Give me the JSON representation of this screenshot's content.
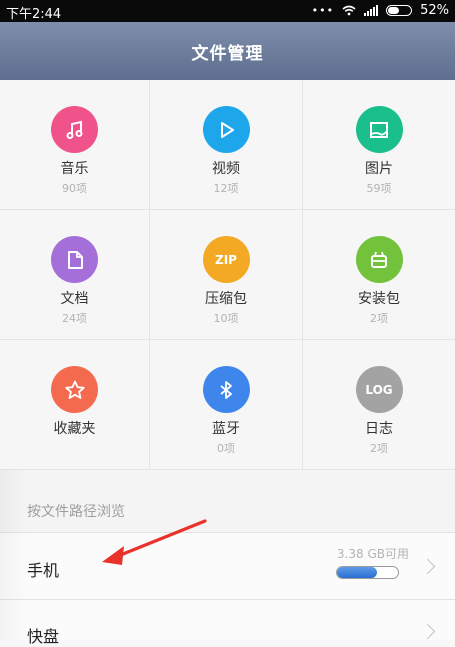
{
  "status_bar": {
    "time": "下午2:44",
    "battery": "52%",
    "battery_level": 0.52
  },
  "header": {
    "title": "文件管理"
  },
  "categories": [
    {
      "label": "音乐",
      "count": "90项",
      "icon": "music-note-icon",
      "color": "#f0528a"
    },
    {
      "label": "视频",
      "count": "12项",
      "icon": "play-icon",
      "color": "#1ea6ea"
    },
    {
      "label": "图片",
      "count": "59项",
      "icon": "image-icon",
      "color": "#1bbf8c"
    },
    {
      "label": "文档",
      "count": "24项",
      "icon": "document-icon",
      "color": "#a56fd9"
    },
    {
      "label": "压缩包",
      "count": "10项",
      "icon": "zip-icon",
      "icon_text": "ZIP",
      "color": "#f3a923"
    },
    {
      "label": "安装包",
      "count": "2项",
      "icon": "package-icon",
      "color": "#72c23b"
    },
    {
      "label": "收藏夹",
      "count": "",
      "icon": "star-icon",
      "color": "#f46a4f"
    },
    {
      "label": "蓝牙",
      "count": "0项",
      "icon": "bluetooth-icon",
      "color": "#3f86ec"
    },
    {
      "label": "日志",
      "count": "2项",
      "icon": "log-icon",
      "icon_text": "LOG",
      "color": "#a3a3a3"
    }
  ],
  "browse_section": {
    "label": "按文件路径浏览"
  },
  "storage_rows": [
    {
      "name": "手机",
      "available": "3.38 GB可用",
      "usage_fraction": 0.65
    },
    {
      "name": "快盘"
    }
  ],
  "colors": {
    "header_top": "#7e8eab",
    "header_bottom": "#5d6e8f",
    "annotation_arrow": "#e8322a"
  }
}
